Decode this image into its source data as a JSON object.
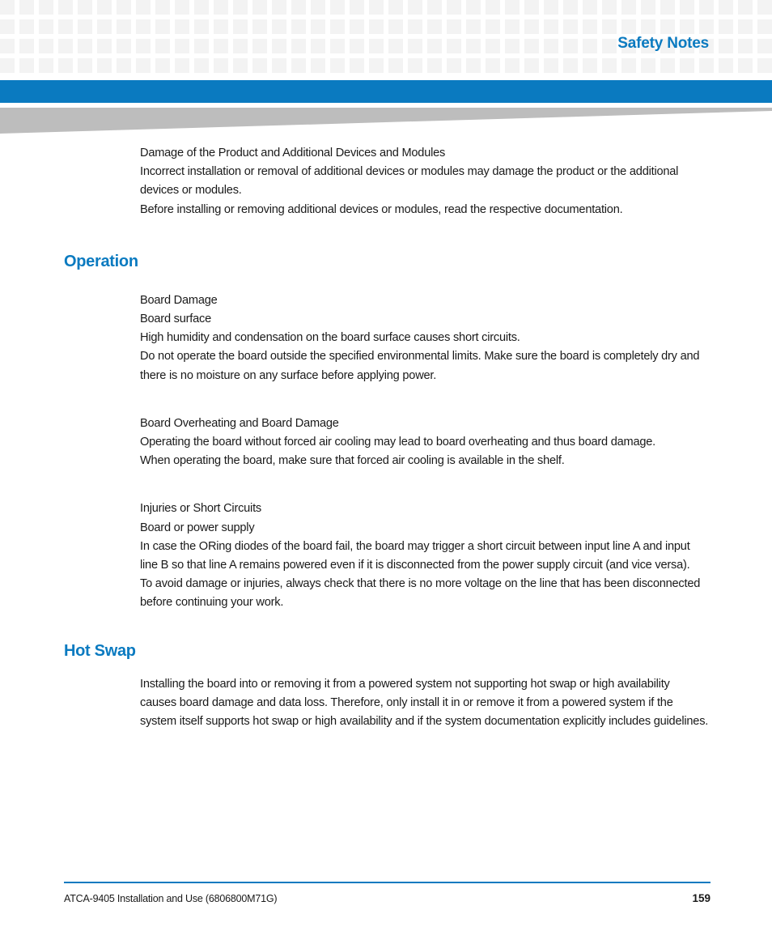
{
  "header": {
    "title": "Safety Notes"
  },
  "colors": {
    "accent_blue": "#0a7ac0",
    "band_blue": "#0a7ac0",
    "wedge_gray": "#bdbdbd",
    "grid_square": "#f3f3f3",
    "body_text": "#1a1a1a"
  },
  "content": {
    "intro": {
      "lines": [
        "Damage of the Product and Additional Devices and Modules",
        "Incorrect installation or removal of additional devices or modules may damage the product or the additional devices or modules.",
        "Before installing or removing additional devices or modules, read the respective documentation."
      ],
      "line1": "Damage of the Product and Additional Devices and Modules",
      "line2": "Incorrect installation or removal of additional devices or modules may damage the product or the additional devices or modules.",
      "line3": "Before installing or removing additional devices or modules, read the respective documentation."
    },
    "operation": {
      "heading": "Operation",
      "board_damage": {
        "title": "Board Damage",
        "subject": "Board surface",
        "cause": "High humidity and condensation on the board surface causes short circuits.",
        "action": "Do not operate the board outside the specified environmental limits. Make sure the board is completely dry and there is no moisture on any surface before applying power."
      },
      "board_overheating": {
        "title": "Board Overheating and Board Damage",
        "cause": "Operating the board without forced air cooling may lead to board overheating and thus board damage.",
        "action": "When operating the board, make sure that forced air cooling is available in the shelf."
      },
      "injuries": {
        "title": "Injuries or Short Circuits",
        "subject": "Board or power supply",
        "cause": "In case the ORing diodes of the board fail, the board may trigger a short circuit between input line A and input line B so that line A remains powered even if it is disconnected from the power supply circuit (and vice versa).",
        "action": "To avoid damage or injuries, always check that there is no more voltage on the line that has been disconnected before continuing your work."
      }
    },
    "hot_swap": {
      "heading": "Hot Swap",
      "body": "Installing the board into or removing it from a powered system not supporting hot swap or high availability causes board damage and data loss. Therefore, only install it in or remove it from a powered system if the system itself supports hot swap or high availability and if the system documentation explicitly includes guidelines."
    }
  },
  "footer": {
    "document_title": "ATCA-9405 Installation and Use (6806800M71G)",
    "page_number": "159"
  }
}
